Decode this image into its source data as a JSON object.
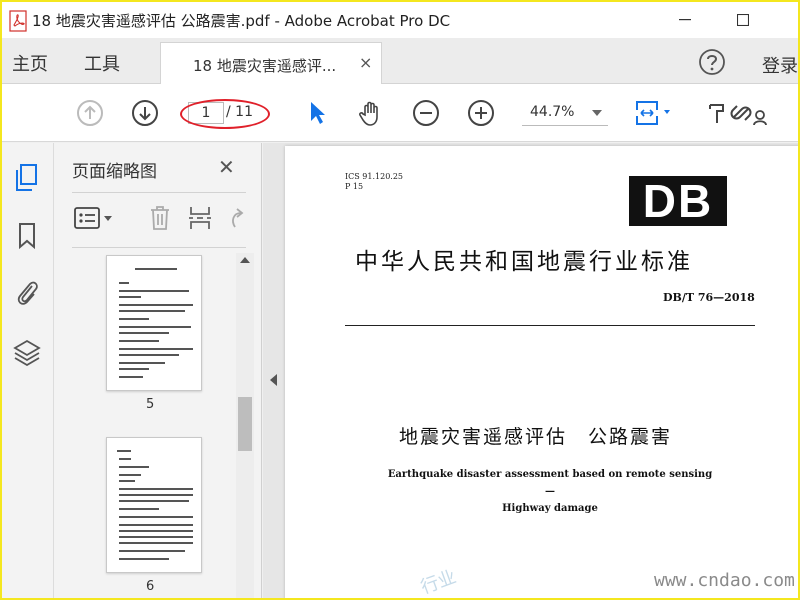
{
  "window": {
    "title": "18 地震灾害遥感评估 公路震害.pdf - Adobe Acrobat Pro DC"
  },
  "tabbar": {
    "home": "主页",
    "tools": "工具",
    "doc_tab": "18 地震灾害遥感评...",
    "close_glyph": "×",
    "login": "登录"
  },
  "toolbar": {
    "current_page": "1",
    "total_pages": "/ 11",
    "zoom": "44.7%"
  },
  "thumbnail_panel": {
    "title": "页面缩略图",
    "close_glyph": "✕",
    "thumbnails": [
      {
        "page_label": "5"
      },
      {
        "page_label": "6"
      }
    ]
  },
  "document": {
    "ics": "ICS 91.120.25",
    "classification": "P 15",
    "logo": "DB",
    "standard_title": "中华人民共和国地震行业标准",
    "standard_code": "DB/T 76—2018",
    "doc_title": "地震灾害遥感评估　公路震害",
    "en_title_line1": "Earthquake disaster assessment based on remote sensing—",
    "en_title_line2": "Highway damage"
  },
  "watermark": {
    "url": "www.cndao.com",
    "faint_text": "行业"
  },
  "colors": {
    "border": "#f4e71f",
    "accent": "#1473e6",
    "annotation": "#e0202a"
  },
  "icons": {
    "app": "acrobat-icon",
    "prev_page": "arrow-up-circle-icon",
    "next_page": "arrow-down-circle-icon",
    "select": "pointer-icon",
    "hand": "hand-icon",
    "zoom_out": "zoom-out-icon",
    "zoom_in": "zoom-in-icon",
    "fit": "fit-page-icon",
    "sign": "sign-icon",
    "share": "link-share-icon",
    "help": "help-icon",
    "pages": "pages-icon",
    "bookmarks": "bookmark-icon",
    "attachments": "paperclip-icon",
    "layers": "layers-icon"
  }
}
